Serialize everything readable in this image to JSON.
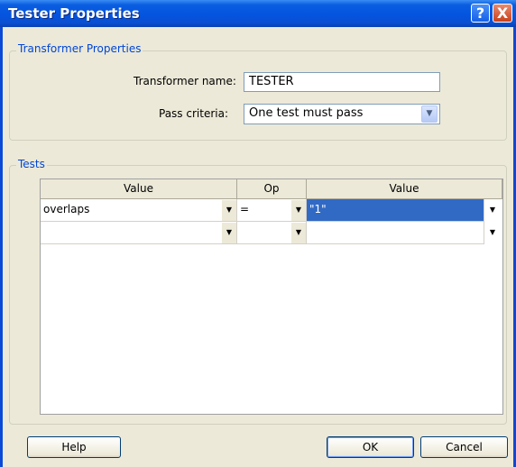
{
  "window": {
    "title": "Tester Properties",
    "help_glyph": "?",
    "close_glyph": "X"
  },
  "transformer_group": {
    "legend": "Transformer Properties",
    "name_label": "Transformer name:",
    "name_value": "TESTER",
    "criteria_label": "Pass criteria:",
    "criteria_value": "One test must pass"
  },
  "tests_group": {
    "legend": "Tests",
    "columns": [
      "Value",
      "Op",
      "Value"
    ],
    "rows": [
      {
        "left": "overlaps",
        "op": "=",
        "right": "\"1\""
      },
      {
        "left": "",
        "op": "",
        "right": ""
      }
    ]
  },
  "buttons": {
    "help": "Help",
    "ok": "OK",
    "cancel": "Cancel"
  },
  "icons": {
    "dropdown": "▼",
    "chevron": "chevron-down"
  },
  "colors": {
    "titlebar": "#0454e0",
    "selection": "#316ac5",
    "legend_text": "#0046d5"
  }
}
